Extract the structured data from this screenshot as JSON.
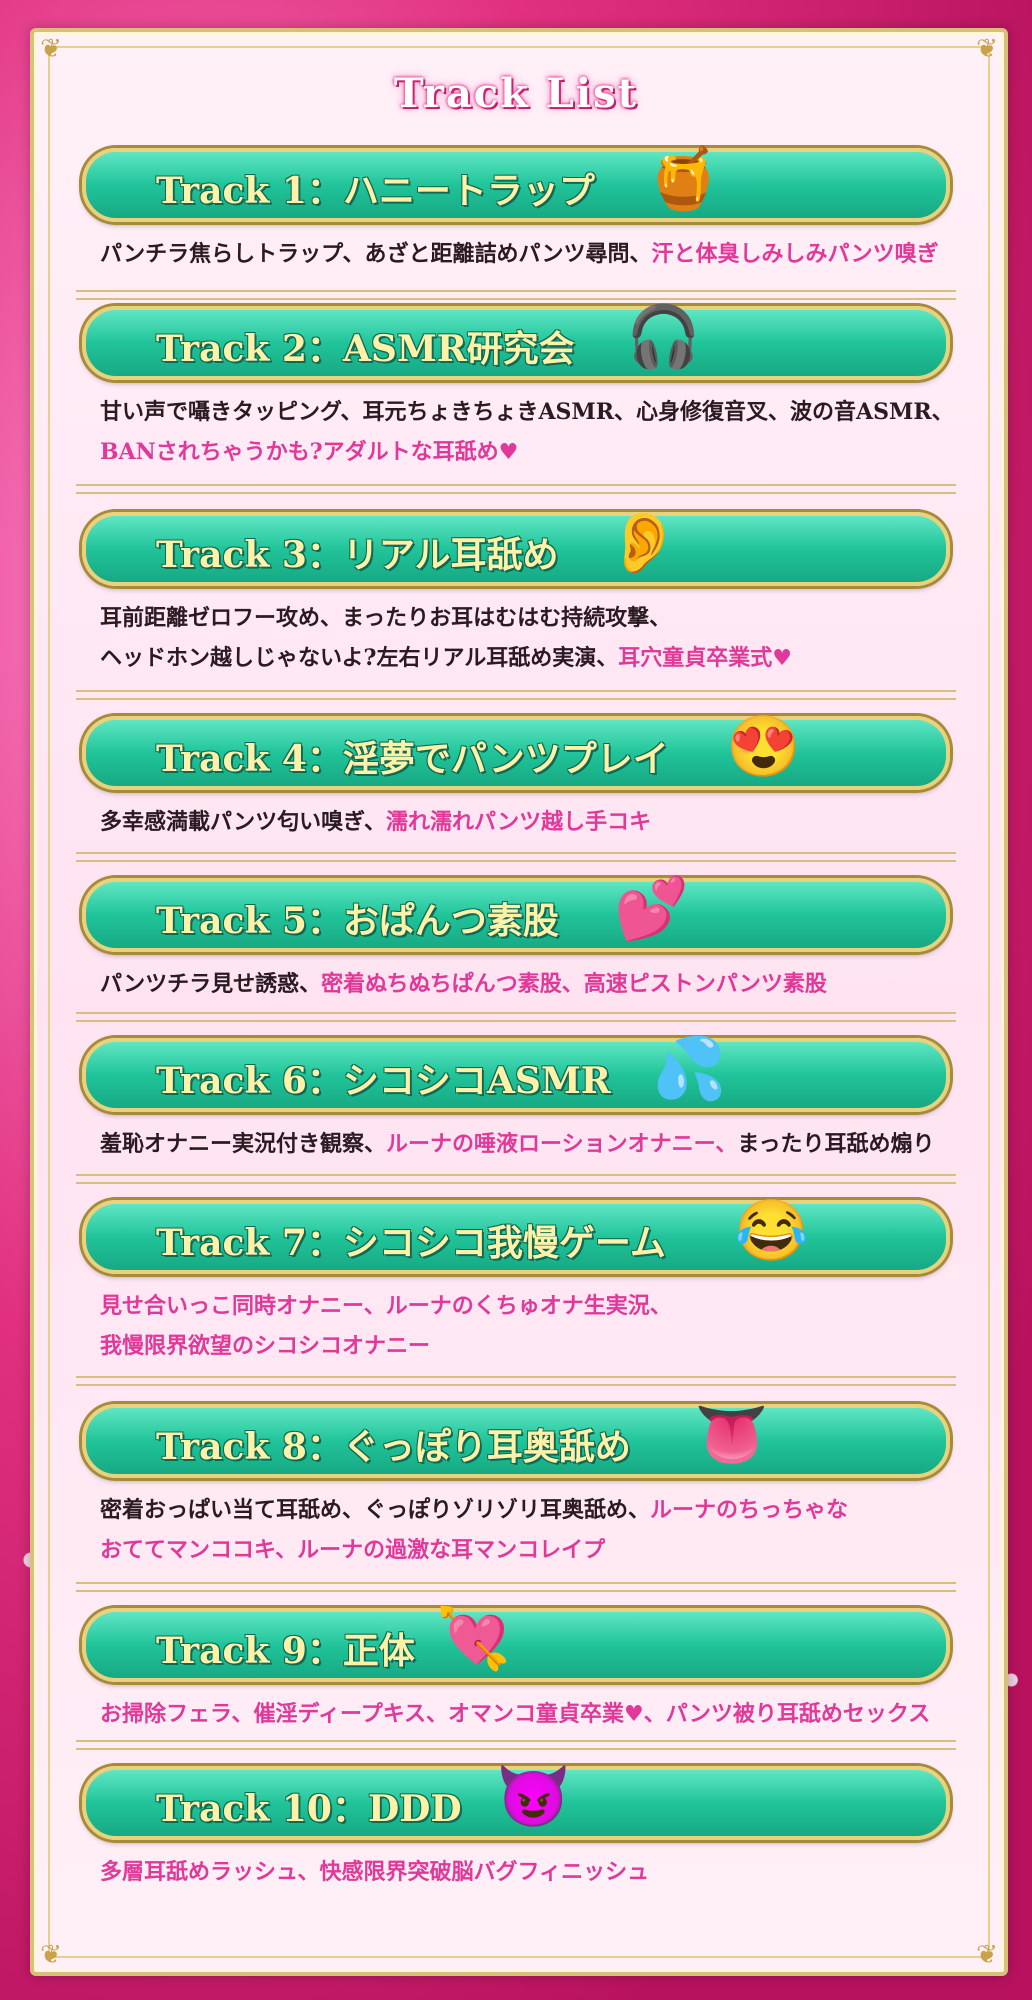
{
  "page": {
    "title": "Track List"
  },
  "tracks": [
    {
      "name": "Track 1：ハニートラップ",
      "emoji": "🍯",
      "desc": [
        [
          {
            "t": "パンチラ焦らしトラップ、あざと距離詰めパンツ尋問、",
            "h": false
          },
          {
            "t": "汗と体臭しみしみパンツ嗅ぎ",
            "h": true
          }
        ]
      ]
    },
    {
      "name": "Track 2：ASMR研究会",
      "emoji": "🎧",
      "desc": [
        [
          {
            "t": "甘い声で囁きタッピング、耳元ちょきちょきASMR、心身修復音叉、波の音ASMR、",
            "h": false
          }
        ],
        [
          {
            "t": "BANされちゃうかも?アダルトな耳舐め♥",
            "h": true
          }
        ]
      ]
    },
    {
      "name": "Track 3：リアル耳舐め",
      "emoji": "👂",
      "desc": [
        [
          {
            "t": "耳前距離ゼロフー攻め、まったりお耳はむはむ持続攻撃、",
            "h": false
          }
        ],
        [
          {
            "t": "ヘッドホン越しじゃないよ?左右リアル耳舐め実演、",
            "h": false
          },
          {
            "t": "耳穴童貞卒業式♥",
            "h": true
          }
        ]
      ]
    },
    {
      "name": "Track 4：淫夢でパンツプレイ",
      "emoji": "😍",
      "desc": [
        [
          {
            "t": "多幸感満載パンツ匂い嗅ぎ、",
            "h": false
          },
          {
            "t": "濡れ濡れパンツ越し手コキ",
            "h": true
          }
        ]
      ]
    },
    {
      "name": "Track 5：おぱんつ素股",
      "emoji": "💕",
      "desc": [
        [
          {
            "t": "パンツチラ見せ誘惑、",
            "h": false
          },
          {
            "t": "密着ぬちぬちぱんつ素股、高速ピストンパンツ素股",
            "h": true
          }
        ]
      ]
    },
    {
      "name": "Track 6：シコシコASMR",
      "emoji": "💦",
      "desc": [
        [
          {
            "t": "羞恥オナニー実況付き観察、",
            "h": false
          },
          {
            "t": "ルーナの唾液ローションオナニー、",
            "h": true
          },
          {
            "t": "まったり耳舐め煽り",
            "h": false
          }
        ]
      ]
    },
    {
      "name": "Track 7：シコシコ我慢ゲーム",
      "emoji": "😂",
      "desc": [
        [
          {
            "t": "見せ合いっこ同時オナニー、ルーナのくちゅオナ生実況、",
            "h": true
          }
        ],
        [
          {
            "t": "我慢限界欲望のシコシコオナニー",
            "h": true
          }
        ]
      ]
    },
    {
      "name": "Track 8：ぐっぽり耳奥舐め",
      "emoji": "👅",
      "desc": [
        [
          {
            "t": "密着おっぱい当て耳舐め、ぐっぽりゾリゾリ耳奥舐め、",
            "h": false
          },
          {
            "t": "ルーナのちっちゃな",
            "h": true
          }
        ],
        [
          {
            "t": "おててマンココキ、ルーナの過激な耳マンコレイプ",
            "h": true
          }
        ]
      ]
    },
    {
      "name": "Track 9：正体",
      "emoji": "💘",
      "desc": [
        [
          {
            "t": "お掃除フェラ、催淫ディープキス、オマンコ童貞卒業♥、パンツ被り耳舐めセックス",
            "h": true
          }
        ]
      ]
    },
    {
      "name": "Track 10：DDD",
      "emoji": "😈",
      "desc": [
        [
          {
            "t": "多層耳舐めラッシュ、快感限界突破脳バグフィニッシュ",
            "h": true
          }
        ]
      ]
    }
  ]
}
